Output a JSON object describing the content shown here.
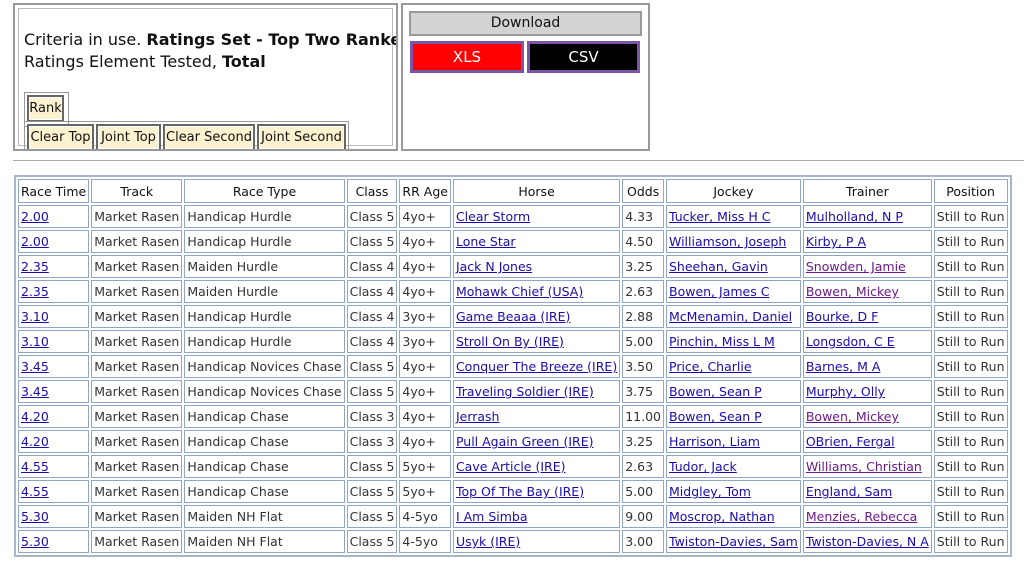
{
  "criteria": {
    "line1_prefix": "Criteria in use. ",
    "line1_value": "Ratings Set - Top Two Ranked NH",
    "line2_prefix": "Ratings Element Tested, ",
    "line2_value": "Total"
  },
  "buttons": {
    "rank": "Rank",
    "clear_top": "Clear Top",
    "joint_top": "Joint Top",
    "clear_second": "Clear Second",
    "joint_second": "Joint Second"
  },
  "download": {
    "title": "Download",
    "xls": "XLS",
    "csv": "CSV",
    "xls_color": "#ff0000",
    "csv_color": "#000000"
  },
  "table": {
    "headers": [
      "Race Time",
      "Track",
      "Race Type",
      "Class",
      "RR Age",
      "Horse",
      "Odds",
      "Jockey",
      "Trainer",
      "Position"
    ],
    "rows": [
      {
        "time": "2.00",
        "track": "Market Rasen",
        "type": "Handicap Hurdle",
        "class": "Class 5",
        "age": "4yo+",
        "horse": "Clear Storm",
        "odds": "4.33",
        "jockey": "Tucker, Miss H C",
        "trainer": "Mulholland, N P",
        "position": "Still to Run",
        "trainer_visited": false
      },
      {
        "time": "2.00",
        "track": "Market Rasen",
        "type": "Handicap Hurdle",
        "class": "Class 5",
        "age": "4yo+",
        "horse": "Lone Star",
        "odds": "4.50",
        "jockey": "Williamson, Joseph",
        "trainer": "Kirby, P A",
        "position": "Still to Run",
        "trainer_visited": false
      },
      {
        "time": "2.35",
        "track": "Market Rasen",
        "type": "Maiden Hurdle",
        "class": "Class 4",
        "age": "4yo+",
        "horse": "Jack N Jones",
        "odds": "3.25",
        "jockey": "Sheehan, Gavin",
        "trainer": "Snowden, Jamie",
        "position": "Still to Run",
        "trainer_visited": true
      },
      {
        "time": "2.35",
        "track": "Market Rasen",
        "type": "Maiden Hurdle",
        "class": "Class 4",
        "age": "4yo+",
        "horse": "Mohawk Chief (USA)",
        "odds": "2.63",
        "jockey": "Bowen, James C",
        "trainer": "Bowen, Mickey",
        "position": "Still to Run",
        "trainer_visited": true
      },
      {
        "time": "3.10",
        "track": "Market Rasen",
        "type": "Handicap Hurdle",
        "class": "Class 4",
        "age": "3yo+",
        "horse": "Game Beaaa (IRE)",
        "odds": "2.88",
        "jockey": "McMenamin, Daniel",
        "trainer": "Bourke, D F",
        "position": "Still to Run",
        "trainer_visited": false
      },
      {
        "time": "3.10",
        "track": "Market Rasen",
        "type": "Handicap Hurdle",
        "class": "Class 4",
        "age": "3yo+",
        "horse": "Stroll On By (IRE)",
        "odds": "5.00",
        "jockey": "Pinchin, Miss L M",
        "trainer": "Longsdon, C E",
        "position": "Still to Run",
        "trainer_visited": false
      },
      {
        "time": "3.45",
        "track": "Market Rasen",
        "type": "Handicap Novices Chase",
        "class": "Class 5",
        "age": "4yo+",
        "horse": "Conquer The Breeze (IRE)",
        "odds": "3.50",
        "jockey": "Price, Charlie",
        "trainer": "Barnes, M A",
        "position": "Still to Run",
        "trainer_visited": false
      },
      {
        "time": "3.45",
        "track": "Market Rasen",
        "type": "Handicap Novices Chase",
        "class": "Class 5",
        "age": "4yo+",
        "horse": "Traveling Soldier (IRE)",
        "odds": "3.75",
        "jockey": "Bowen, Sean P",
        "trainer": "Murphy, Olly",
        "position": "Still to Run",
        "trainer_visited": false
      },
      {
        "time": "4.20",
        "track": "Market Rasen",
        "type": "Handicap Chase",
        "class": "Class 3",
        "age": "4yo+",
        "horse": "Jerrash",
        "odds": "11.00",
        "jockey": "Bowen, Sean P",
        "trainer": "Bowen, Mickey",
        "position": "Still to Run",
        "trainer_visited": true
      },
      {
        "time": "4.20",
        "track": "Market Rasen",
        "type": "Handicap Chase",
        "class": "Class 3",
        "age": "4yo+",
        "horse": "Pull Again Green (IRE)",
        "odds": "3.25",
        "jockey": "Harrison, Liam",
        "trainer": "OBrien, Fergal",
        "position": "Still to Run",
        "trainer_visited": false
      },
      {
        "time": "4.55",
        "track": "Market Rasen",
        "type": "Handicap Chase",
        "class": "Class 5",
        "age": "5yo+",
        "horse": "Cave Article (IRE)",
        "odds": "2.63",
        "jockey": "Tudor, Jack",
        "trainer": "Williams, Christian",
        "position": "Still to Run",
        "trainer_visited": true
      },
      {
        "time": "4.55",
        "track": "Market Rasen",
        "type": "Handicap Chase",
        "class": "Class 5",
        "age": "5yo+",
        "horse": "Top Of The Bay (IRE)",
        "odds": "5.00",
        "jockey": "Midgley, Tom",
        "trainer": "England, Sam",
        "position": "Still to Run",
        "trainer_visited": false
      },
      {
        "time": "5.30",
        "track": "Market Rasen",
        "type": "Maiden NH Flat",
        "class": "Class 5",
        "age": "4-5yo",
        "horse": "I Am Simba",
        "odds": "9.00",
        "jockey": "Moscrop, Nathan",
        "trainer": "Menzies, Rebecca",
        "position": "Still to Run",
        "trainer_visited": true
      },
      {
        "time": "5.30",
        "track": "Market Rasen",
        "type": "Maiden NH Flat",
        "class": "Class 5",
        "age": "4-5yo",
        "horse": "Usyk (IRE)",
        "odds": "3.00",
        "jockey": "Twiston-Davies, Sam",
        "trainer": "Twiston-Davies, N A",
        "position": "Still to Run",
        "trainer_visited": false
      }
    ]
  }
}
